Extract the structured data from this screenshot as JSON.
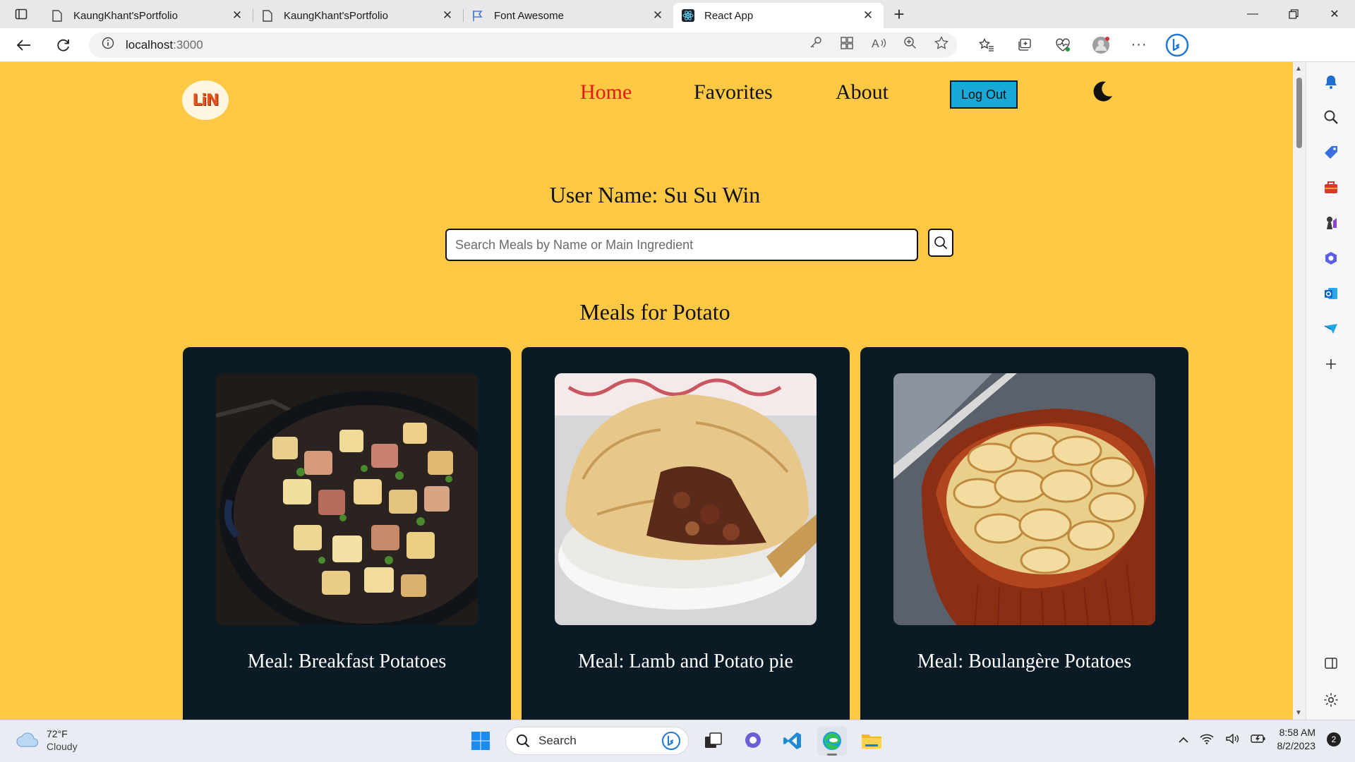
{
  "browser": {
    "tabs": [
      {
        "title": "KaungKhant'sPortfolio",
        "icon": "page-icon",
        "active": false
      },
      {
        "title": "KaungKhant'sPortfolio",
        "icon": "page-icon",
        "active": false
      },
      {
        "title": "Font Awesome",
        "icon": "flag-icon",
        "active": false
      },
      {
        "title": "React App",
        "icon": "react-icon",
        "active": true
      }
    ],
    "url_host": "localhost",
    "url_port": ":3000"
  },
  "app": {
    "logo_text": "LiN",
    "nav": {
      "home": "Home",
      "favorites": "Favorites",
      "about": "About",
      "logout": "Log Out"
    },
    "username_line": "User Name: Su Su Win",
    "search_placeholder": "Search Meals by Name or Main Ingredient",
    "section_title": "Meals for Potato",
    "meals": [
      {
        "label": "Meal: Breakfast Potatoes",
        "image": "skillet-potatoes"
      },
      {
        "label": "Meal: Lamb and Potato pie",
        "image": "lamb-pie"
      },
      {
        "label": "Meal: Boulangère Potatoes",
        "image": "potato-bake"
      }
    ],
    "colors": {
      "background": "#fdc844",
      "card": "#0b1b26",
      "active_link": "#e8170f",
      "logout_button": "#1aa9d6"
    }
  },
  "taskbar": {
    "weather_temp": "72°F",
    "weather_cond": "Cloudy",
    "search_label": "Search",
    "time": "8:58 AM",
    "date": "8/2/2023",
    "notifications": "2"
  }
}
